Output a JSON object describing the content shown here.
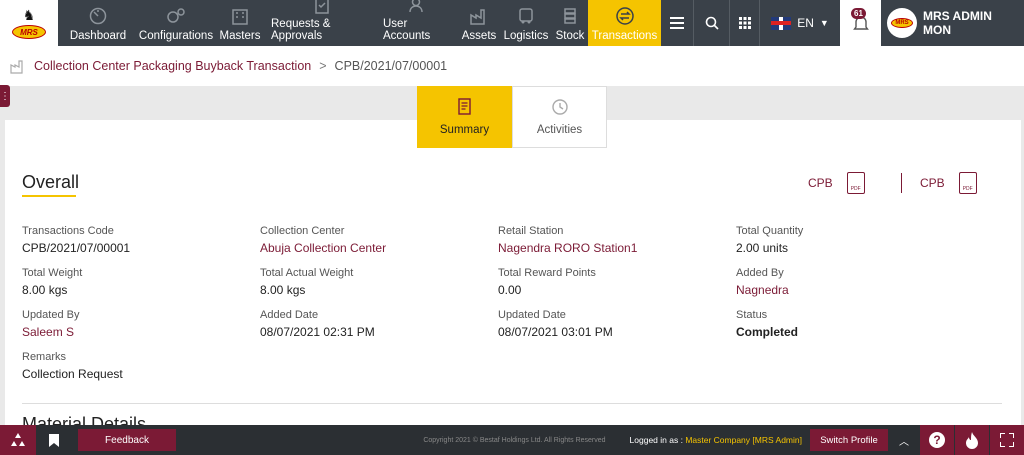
{
  "header": {
    "logo_text": "MRS",
    "nav": [
      {
        "label": "Dashboard",
        "icon": "dashboard-icon"
      },
      {
        "label": "Configurations",
        "icon": "gears-icon"
      },
      {
        "label": "Masters",
        "icon": "building-icon"
      },
      {
        "label": "Requests & Approvals",
        "icon": "document-check-icon"
      },
      {
        "label": "User Accounts",
        "icon": "users-icon"
      },
      {
        "label": "Assets",
        "icon": "factory-icon"
      },
      {
        "label": "Logistics",
        "icon": "truck-icon"
      },
      {
        "label": "Stock",
        "icon": "stack-icon"
      },
      {
        "label": "Transactions",
        "icon": "exchange-icon"
      }
    ],
    "language": "EN",
    "notification_count": "61",
    "user_name": "MRS ADMIN",
    "user_sub": "MON"
  },
  "breadcrumb": {
    "parent": "Collection Center Packaging Buyback Transaction",
    "separator": ">",
    "current": "CPB/2021/07/00001"
  },
  "tabs": [
    {
      "label": "Summary",
      "active": true
    },
    {
      "label": "Activities",
      "active": false
    }
  ],
  "overall": {
    "title": "Overall",
    "downloads": [
      {
        "label": "CPB"
      },
      {
        "label": "CPB"
      }
    ],
    "fields": [
      {
        "label": "Transactions Code",
        "value": "CPB/2021/07/00001",
        "link": false
      },
      {
        "label": "Collection Center",
        "value": "Abuja Collection Center",
        "link": true
      },
      {
        "label": "Retail Station",
        "value": "Nagendra RORO Station1",
        "link": true
      },
      {
        "label": "Total Quantity",
        "value": "2.00 units",
        "link": false
      },
      {
        "label": "Total Weight",
        "value": "8.00 kgs",
        "link": false
      },
      {
        "label": "Total Actual Weight",
        "value": "8.00 kgs",
        "link": false
      },
      {
        "label": "Total Reward Points",
        "value": "0.00",
        "link": false
      },
      {
        "label": "Added By",
        "value": "Nagnedra",
        "link": true
      },
      {
        "label": "Updated By",
        "value": "Saleem S",
        "link": true
      },
      {
        "label": "Added Date",
        "value": "08/07/2021 02:31 PM",
        "link": false
      },
      {
        "label": "Updated Date",
        "value": "08/07/2021 03:01 PM",
        "link": false
      },
      {
        "label": "Status",
        "value": "Completed",
        "link": false
      },
      {
        "label": "Remarks",
        "value": "Collection Request",
        "link": false
      }
    ]
  },
  "next_section_title": "Material Details",
  "footer": {
    "feedback": "Feedback",
    "copyright": "Copyright 2021 © Bestaf Holdings Ltd. All Rights Reserved",
    "logged_in_label": "Logged in as :",
    "logged_in_value": "Master Company [MRS Admin]",
    "switch_profile": "Switch Profile"
  },
  "colors": {
    "accent": "#f5c400",
    "brand": "#7b1a35",
    "nav_bg": "#3a4149"
  }
}
